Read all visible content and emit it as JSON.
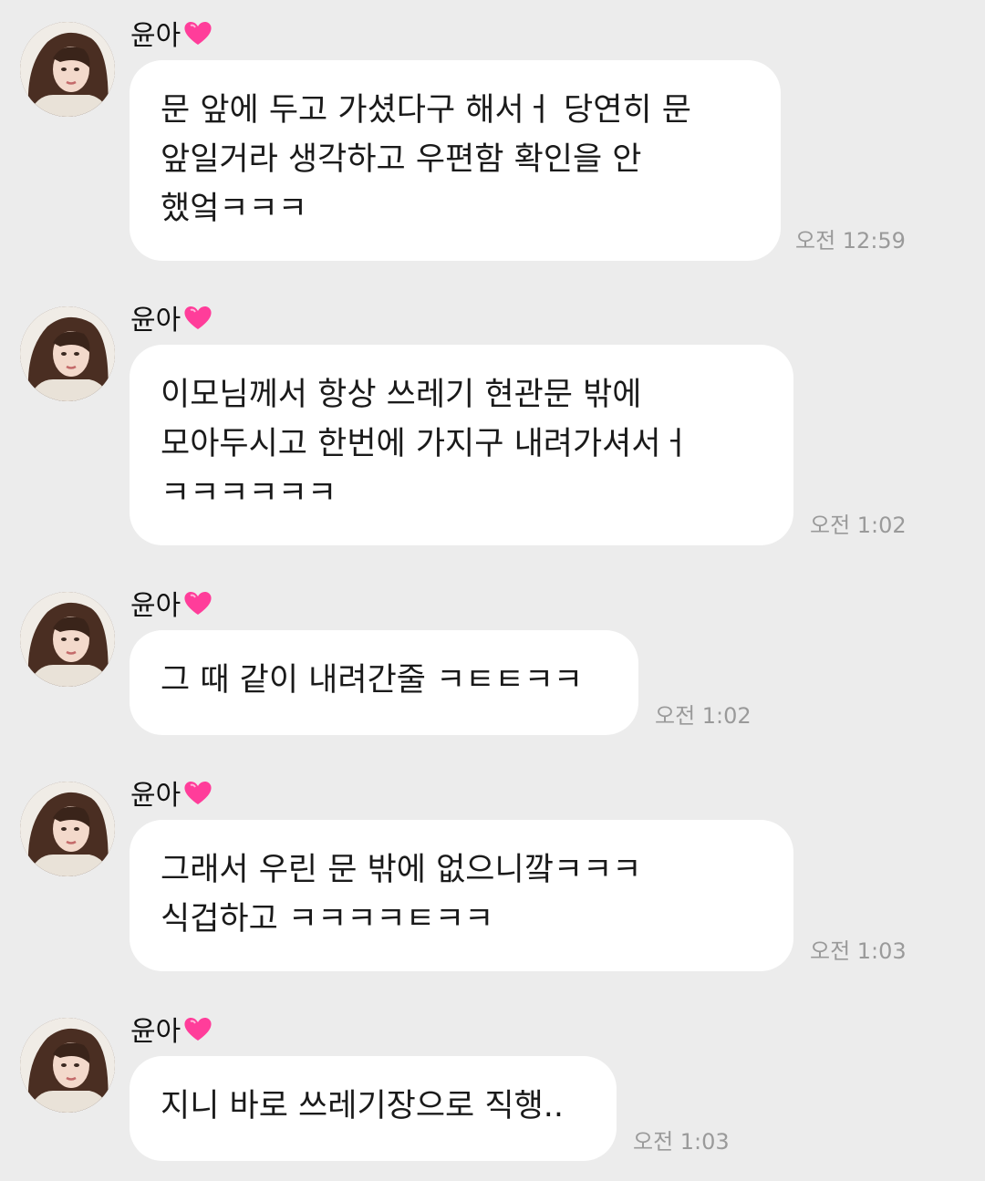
{
  "chat": {
    "accent_heart_color": "#ff3d9a",
    "bubble_color": "#ffffff",
    "background_color": "#ececec",
    "messages": [
      {
        "sender": "윤아",
        "text": "문 앞에 두고 가셨다구 해서ㅓ 당연히 문\n앞일거라 생각하고 우편함 확인을 안\n했엌ㅋㅋㅋ",
        "time": "오전 12:59"
      },
      {
        "sender": "윤아",
        "text": "이모님께서 항상 쓰레기 현관문 밖에\n모아두시고 한번에 가지구 내려가셔서ㅓ\nㅋㅋㅋㅋㅋㅋ",
        "time": "오전 1:02"
      },
      {
        "sender": "윤아",
        "text": "그 때 같이 내려간줄 ㅋㅌㅌㅋㅋ",
        "time": "오전 1:02"
      },
      {
        "sender": "윤아",
        "text": "그래서 우린 문 밖에 없으니깤ㅋㅋㅋ\n식겁하고 ㅋㅋㅋㅋㅌㅋㅋ",
        "time": "오전 1:03"
      },
      {
        "sender": "윤아",
        "text": "지니 바로 쓰레기장으로 직행..",
        "time": "오전 1:03"
      }
    ]
  }
}
